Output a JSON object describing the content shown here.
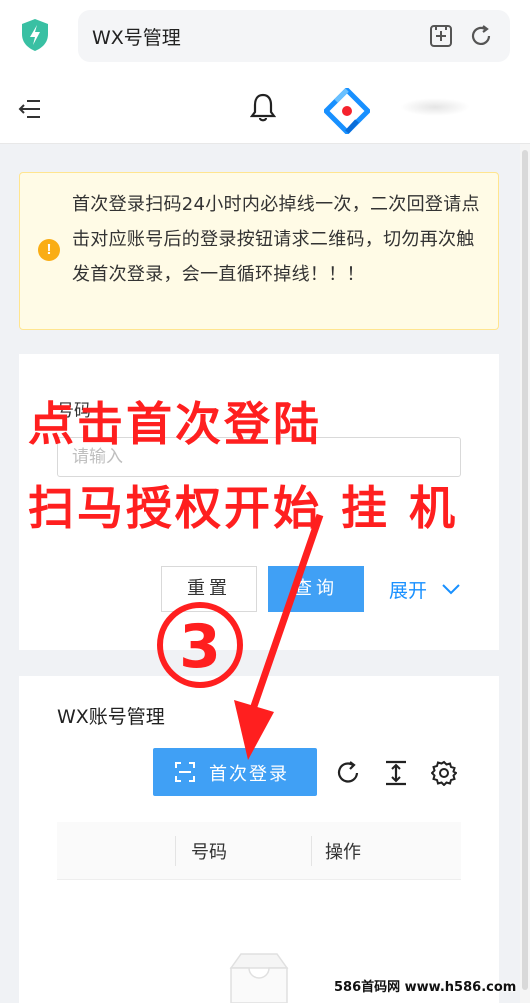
{
  "browser": {
    "url_text": "WX号管理",
    "icons": [
      "shield-icon",
      "add-tab-icon",
      "reload-icon"
    ]
  },
  "header": {
    "icons": [
      "menu-fold-icon",
      "bell-icon",
      "logo-icon"
    ]
  },
  "alert": {
    "icon": "exclamation-icon",
    "icon_glyph": "!",
    "text": "首次登录扫码24小时内必掉线一次，二次回登请点击对应账号后的登录按钮请求二维码，切勿再次触发首次登录，会一直循环掉线！！！",
    "color": "#faad14"
  },
  "search": {
    "field_label": "号码",
    "field_placeholder": "请输入",
    "reset_label": "重置",
    "query_label": "查询",
    "expand_label": "展开"
  },
  "table_card": {
    "title": "WX账号管理",
    "first_login_label": "首次登录",
    "tool_icons": [
      "reload-icon",
      "column-height-icon",
      "setting-icon"
    ],
    "columns": [
      "",
      "号码",
      "操作"
    ],
    "rows": []
  },
  "overlay": {
    "line1": "点击首次登陆",
    "line2": "扫马授权开始 挂 机",
    "step_marker": "③",
    "color": "#ff1f1f"
  },
  "watermark": "586首码网 www.h586.com",
  "colors": {
    "primary": "#40a0f5",
    "link": "#1890ff",
    "logo_blue": "#1890ff",
    "logo_red": "#f5222d"
  }
}
